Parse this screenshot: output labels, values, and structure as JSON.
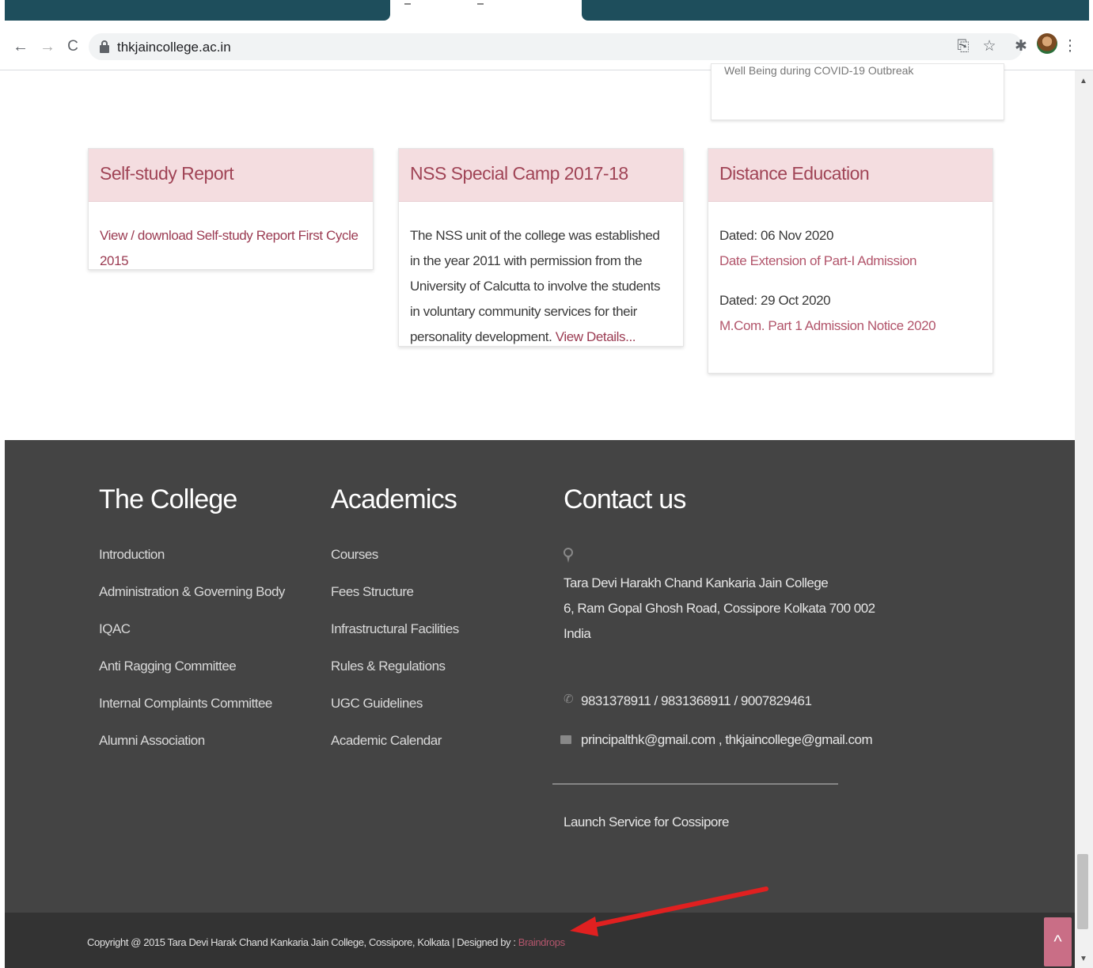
{
  "browser": {
    "url": "thkjaincollege.ac.in",
    "back_glyph": "←",
    "forward_glyph": "→",
    "reload_glyph": "C",
    "share_glyph": "⎘",
    "star_glyph": "☆",
    "extensions_glyph": "✱",
    "menu_glyph": "⋮"
  },
  "previous_card": {
    "partial_text": "Well Being during COVID-19 Outbreak"
  },
  "cards": [
    {
      "title": "Self-study Report",
      "link": "View / download Self-study Report First Cycle 2015"
    },
    {
      "title": "NSS Special Camp 2017-18",
      "text": "The NSS unit of the college was established in the year 2011 with permission from the University of Calcutta to involve the students in voluntary community services for their personality development.",
      "link": "View Details..."
    },
    {
      "title": "Distance Education",
      "notices": [
        {
          "date": "Dated: 06 Nov 2020",
          "link": "Date Extension of Part-I Admission"
        },
        {
          "date": "Dated: 29 Oct 2020",
          "link": "M.Com. Part 1 Admission Notice 2020"
        }
      ]
    }
  ],
  "footer": {
    "college": {
      "heading": "The College",
      "items": [
        "Introduction",
        "Administration & Governing Body",
        "IQAC",
        "Anti Ragging Committee",
        "Internal Complaints Committee",
        "Alumni Association"
      ]
    },
    "academics": {
      "heading": "Academics",
      "items": [
        "Courses",
        "Fees Structure",
        "Infrastructural Facilities",
        "Rules & Regulations",
        "UGC Guidelines",
        "Academic Calendar"
      ]
    },
    "contact": {
      "heading": "Contact us",
      "address_lines": [
        "Tara Devi Harakh Chand Kankaria Jain College",
        "6, Ram Gopal Ghosh Road, Cossipore Kolkata 700 002",
        "India"
      ],
      "phone": "9831378911 / 9831368911 / 9007829461",
      "email": "principalthk@gmail.com , thkjaincollege@gmail.com",
      "launch_link": "Launch Service for Cossipore"
    }
  },
  "bottom_bar": {
    "copyright": "Copyright @ 2015  Tara Devi Harak Chand Kankaria Jain College, Cossipore, Kolkata  |  Designed by : ",
    "designer": "Braindrops",
    "back_to_top_glyph": "^"
  },
  "colors": {
    "accent": "#b2556b",
    "card_header": "#f4dde0",
    "footer_bg": "#444444",
    "bottom_bar_bg": "#333333",
    "annotation": "#e02020"
  }
}
